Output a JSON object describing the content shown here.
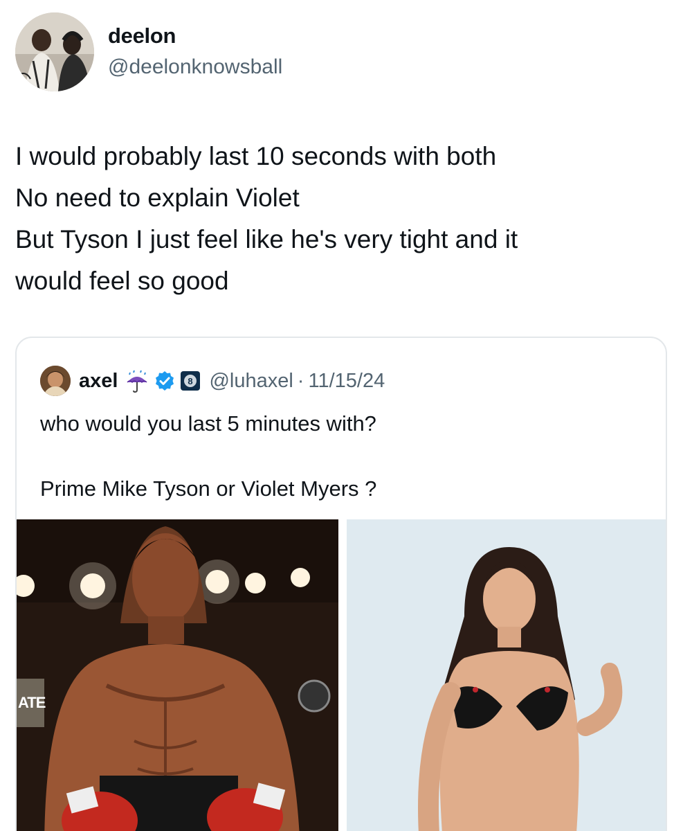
{
  "author": {
    "display_name": "deelon",
    "handle": "@deelonknowsball",
    "avatar_icon": "profile-photo-avatar"
  },
  "post": {
    "lines": [
      "I would probably last 10 seconds with both",
      "No need to explain Violet",
      "But Tyson I just feel like he's very tight and it",
      "would feel so good"
    ]
  },
  "quoted": {
    "display_name": "axel",
    "emoji_icon": "umbrella-rain-icon",
    "verified_icon": "verified-badge-icon",
    "affiliate_icon": "affiliate-badge-icon",
    "handle": "@luhaxel",
    "separator": "·",
    "date": "11/15/24",
    "text_line_1": "who would you last 5 minutes with?",
    "text_line_2": "Prime Mike Tyson or Violet Myers ?",
    "media": [
      {
        "icon": "boxer-photo",
        "overlay_text": "ATE"
      },
      {
        "icon": "woman-photo"
      }
    ]
  },
  "colors": {
    "text": "#0f1419",
    "muted": "#536471",
    "verified": "#1d9bf0",
    "border": "#e3e7ea"
  }
}
